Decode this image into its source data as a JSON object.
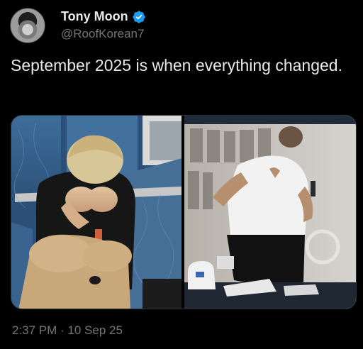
{
  "tweet": {
    "display_name": "Tony Moon",
    "handle": "@RoofKorean7",
    "verified": true,
    "text": "September 2025 is when everything changed.",
    "timestamp": "2:37 PM · 10 Sep 25",
    "photo_count": 2
  },
  "icons": {
    "verified_badge": "verified-badge-icon"
  },
  "colors": {
    "background": "#000000",
    "primary_text": "#e7e9ea",
    "secondary_text": "#71767b",
    "verified_blue": "#1d9bf0"
  }
}
